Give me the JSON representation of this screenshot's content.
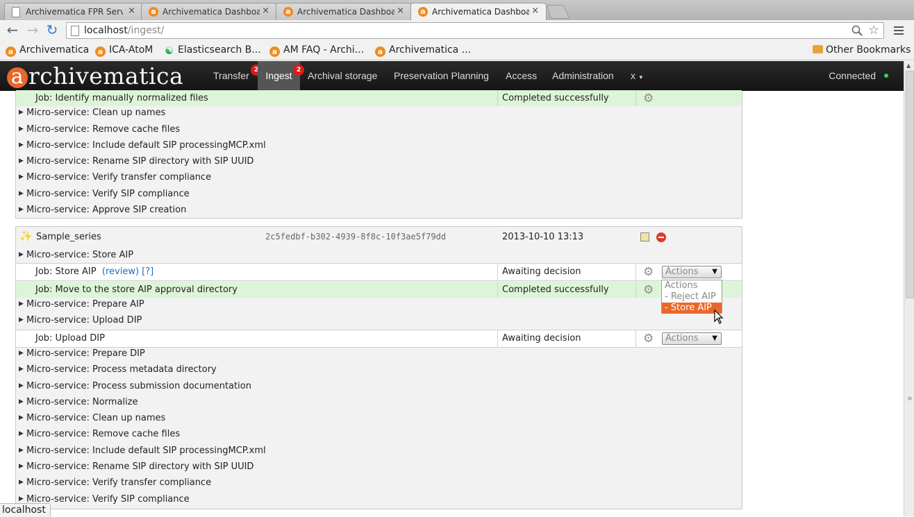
{
  "browser": {
    "tabs": [
      {
        "title": "Archivematica FPR Server",
        "favicon": "page-icon",
        "active": false
      },
      {
        "title": "Archivematica Dashboard",
        "favicon": "archivematica-icon",
        "active": false
      },
      {
        "title": "Archivematica Dashboard",
        "favicon": "archivematica-icon",
        "active": false
      },
      {
        "title": "Archivematica Dashboard",
        "favicon": "archivematica-icon",
        "active": true
      }
    ],
    "close_glyph": "×",
    "url_host": "localhost",
    "url_path": "/ingest/",
    "bookmarks": [
      {
        "label": "Archivematica"
      },
      {
        "label": "ICA-AtoM"
      },
      {
        "label": "Elasticsearch B..."
      },
      {
        "label": "AM FAQ - Archi..."
      },
      {
        "label": "Archivematica ..."
      }
    ],
    "other_bookmarks": "Other Bookmarks",
    "status_url": "localhost"
  },
  "app": {
    "logo_letter": "a",
    "logo_rest": "rchivematica",
    "nav": [
      {
        "label": "Transfer",
        "badge": "2"
      },
      {
        "label": "Ingest",
        "badge": "2",
        "active": true
      },
      {
        "label": "Archival storage"
      },
      {
        "label": "Preservation Planning"
      },
      {
        "label": "Access"
      },
      {
        "label": "Administration"
      },
      {
        "label": "x"
      }
    ],
    "connection_status": "Connected",
    "accent_color": "#e9672b"
  },
  "group1": {
    "top_job": {
      "label": "Job: Identify manually normalized files",
      "status": "Completed successfully"
    },
    "services": [
      "Micro-service: Clean up names",
      "Micro-service: Remove cache files",
      "Micro-service: Include default SIP processingMCP.xml",
      "Micro-service: Rename SIP directory with SIP UUID",
      "Micro-service: Verify transfer compliance",
      "Micro-service: Verify SIP compliance",
      "Micro-service: Approve SIP creation"
    ]
  },
  "sip": {
    "name": "Sample_series",
    "uuid": "2c5fedbf-b302-4939-8f8c-10f3ae5f79dd",
    "timestamp": "2013-10-10 13:13",
    "store_service": "Micro-service: Store AIP",
    "store_job": {
      "label": "Job: Store AIP",
      "review": "(review)",
      "help": "[?]",
      "status": "Awaiting decision",
      "select_value": "Actions"
    },
    "move_job": {
      "label": "Job: Move to the store AIP approval directory",
      "status": "Completed successfully"
    },
    "prepare_aip": "Micro-service: Prepare AIP",
    "upload_dip": "Micro-service: Upload DIP",
    "upload_job": {
      "label": "Job: Upload DIP",
      "status": "Awaiting decision",
      "select_value": "Actions"
    },
    "services": [
      "Micro-service: Prepare DIP",
      "Micro-service: Process metadata directory",
      "Micro-service: Process submission documentation",
      "Micro-service: Normalize",
      "Micro-service: Clean up names",
      "Micro-service: Remove cache files",
      "Micro-service: Include default SIP processingMCP.xml",
      "Micro-service: Rename SIP directory with SIP UUID",
      "Micro-service: Verify transfer compliance",
      "Micro-service: Verify SIP compliance"
    ]
  },
  "dropdown": {
    "options": [
      "Actions",
      "- Reject AIP",
      "- Store AIP"
    ],
    "highlighted": 2
  }
}
